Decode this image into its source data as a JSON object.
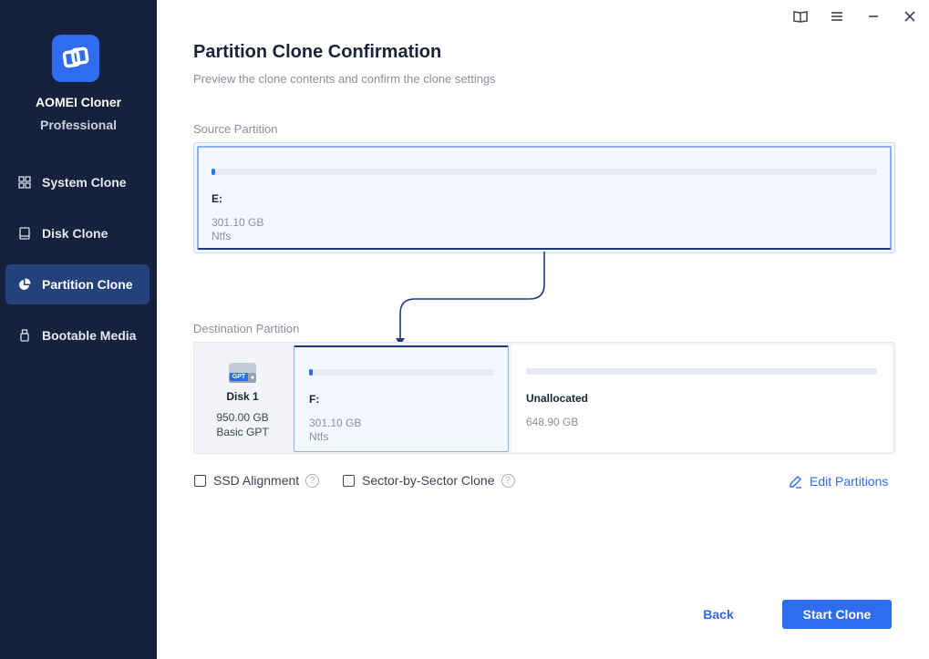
{
  "app": {
    "name": "AOMEI Cloner",
    "edition": "Professional"
  },
  "sidebar": {
    "items": [
      {
        "label": "System Clone",
        "icon": "grid-icon",
        "active": false
      },
      {
        "label": "Disk Clone",
        "icon": "disk-icon",
        "active": false
      },
      {
        "label": "Partition Clone",
        "icon": "pie-chart-icon",
        "active": true
      },
      {
        "label": "Bootable Media",
        "icon": "usb-drive-icon",
        "active": false
      }
    ]
  },
  "window_controls": [
    "book-icon",
    "menu-icon",
    "minimize-icon",
    "close-icon"
  ],
  "main": {
    "title": "Partition Clone Confirmation",
    "subtitle": "Preview the clone contents and confirm the clone settings",
    "source": {
      "label": "Source Partition",
      "drive": "E:",
      "size": "301.10 GB",
      "fs": "Ntfs",
      "used_fraction": 0.005
    },
    "destination": {
      "label": "Destination Partition",
      "disk": {
        "badge": "GPT",
        "name": "Disk 1",
        "size": "950.00 GB",
        "type": "Basic GPT"
      },
      "partition": {
        "drive": "F:",
        "size": "301.10 GB",
        "fs": "Ntfs",
        "used_fraction": 0.02
      },
      "unallocated": {
        "label": "Unallocated",
        "size": "648.90 GB"
      }
    },
    "options": {
      "ssd_alignment": {
        "label": "SSD Alignment",
        "checked": false
      },
      "sector_by_sector": {
        "label": "Sector-by-Sector Clone",
        "checked": false
      },
      "help_glyph": "?"
    },
    "edit_partitions": "Edit Partitions",
    "buttons": {
      "back": "Back",
      "start": "Start Clone"
    }
  },
  "colors": {
    "sidebar_bg": "#16213d",
    "sidebar_active": "#23417a",
    "accent": "#2f6cf0",
    "connector": "#1c3a7a"
  }
}
